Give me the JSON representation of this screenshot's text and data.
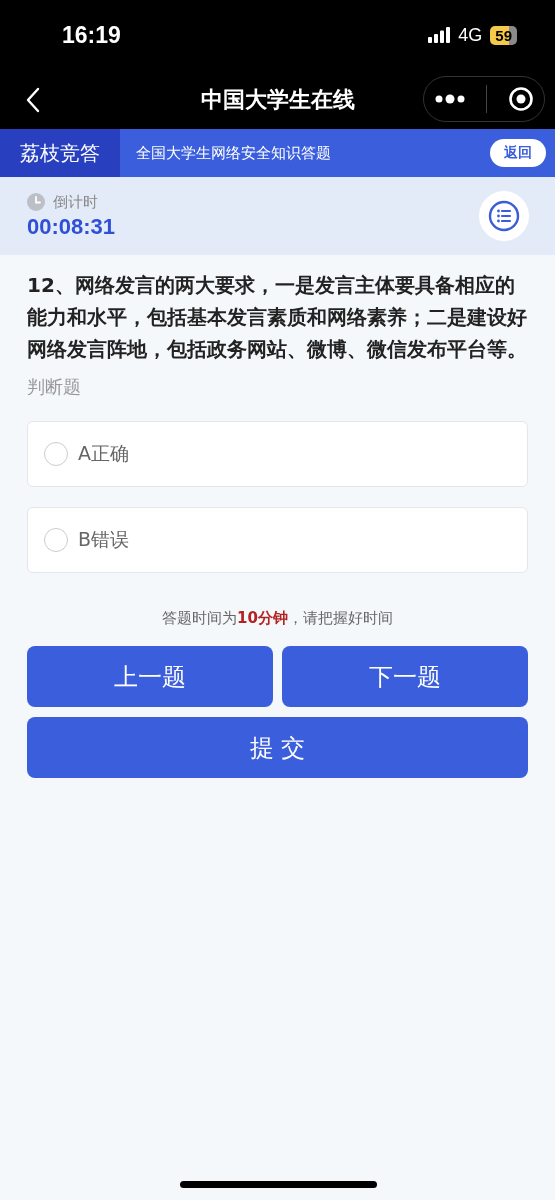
{
  "status_bar": {
    "time": "16:19",
    "network": "4G",
    "battery": "59"
  },
  "nav_bar": {
    "title": "中国大学生在线"
  },
  "banner": {
    "brand": "荔枝竞答",
    "subtitle": "全国大学生网络安全知识答题",
    "back_button": "返回"
  },
  "timer": {
    "label": "倒计时",
    "value": "00:08:31"
  },
  "question": {
    "text": "12、网络发言的两大要求，一是发言主体要具备相应的能力和水平，包括基本发言素质和网络素养；二是建设好网络发言阵地，包括政务网站、微博、微信发布平台等。",
    "type": "判断题",
    "options": [
      {
        "label": "A正确",
        "selected": false
      },
      {
        "label": "B错误",
        "selected": false
      }
    ]
  },
  "notice": "答题时间为**10分钟**，请把握好时间",
  "buttons": {
    "previous": "上一题",
    "next": "下一题",
    "submit": "提 交"
  }
}
